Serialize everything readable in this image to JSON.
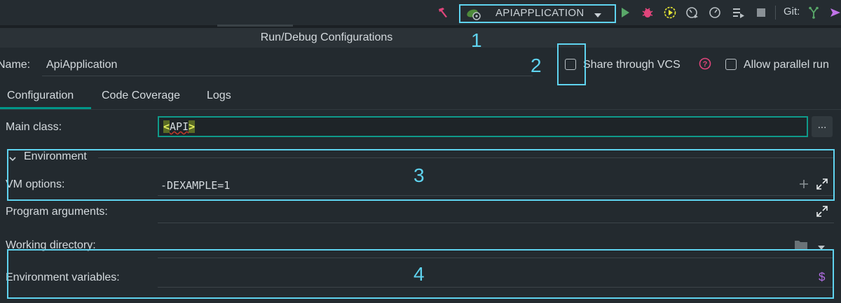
{
  "toolbar": {
    "run_config_label": "APIAPPLICATION",
    "git_label": "Git:",
    "icons": [
      "build-hammer-icon",
      "spring-config-icon",
      "dropdown-caret-icon",
      "run-icon",
      "debug-icon",
      "run-with-coverage-icon",
      "profiler-icon",
      "clock-icon",
      "run-list-icon",
      "stop-icon",
      "git-branch-icon",
      "git-push-icon"
    ],
    "colors": {
      "run": "#59a869",
      "debug": "#e0457b",
      "coverage": "#e6e635",
      "hammer": "#e0457b",
      "accent": "#5fd3ef"
    }
  },
  "dialog": {
    "title": "Run/Debug Configurations",
    "name_label": "Name:",
    "name_value": "ApiApplication",
    "share_vcs_label": "Share through VCS",
    "allow_parallel_label": "Allow parallel run",
    "tabs": [
      {
        "label": "Configuration",
        "active": true
      },
      {
        "label": "Code Coverage",
        "active": false
      },
      {
        "label": "Logs",
        "active": false
      }
    ],
    "main_class_label": "Main class:",
    "main_class_value": "API",
    "ellipsis_label": "...",
    "environment_label": "Environment",
    "vm_options_label": "VM options:",
    "vm_options_value": "-DEXAMPLE=1",
    "program_args_label": "Program arguments:",
    "working_dir_label": "Working directory:",
    "env_vars_label": "Environment variables:",
    "env_vars_symbol": "$"
  },
  "annotations": {
    "one": "1",
    "two": "2",
    "three": "3",
    "four": "4"
  }
}
